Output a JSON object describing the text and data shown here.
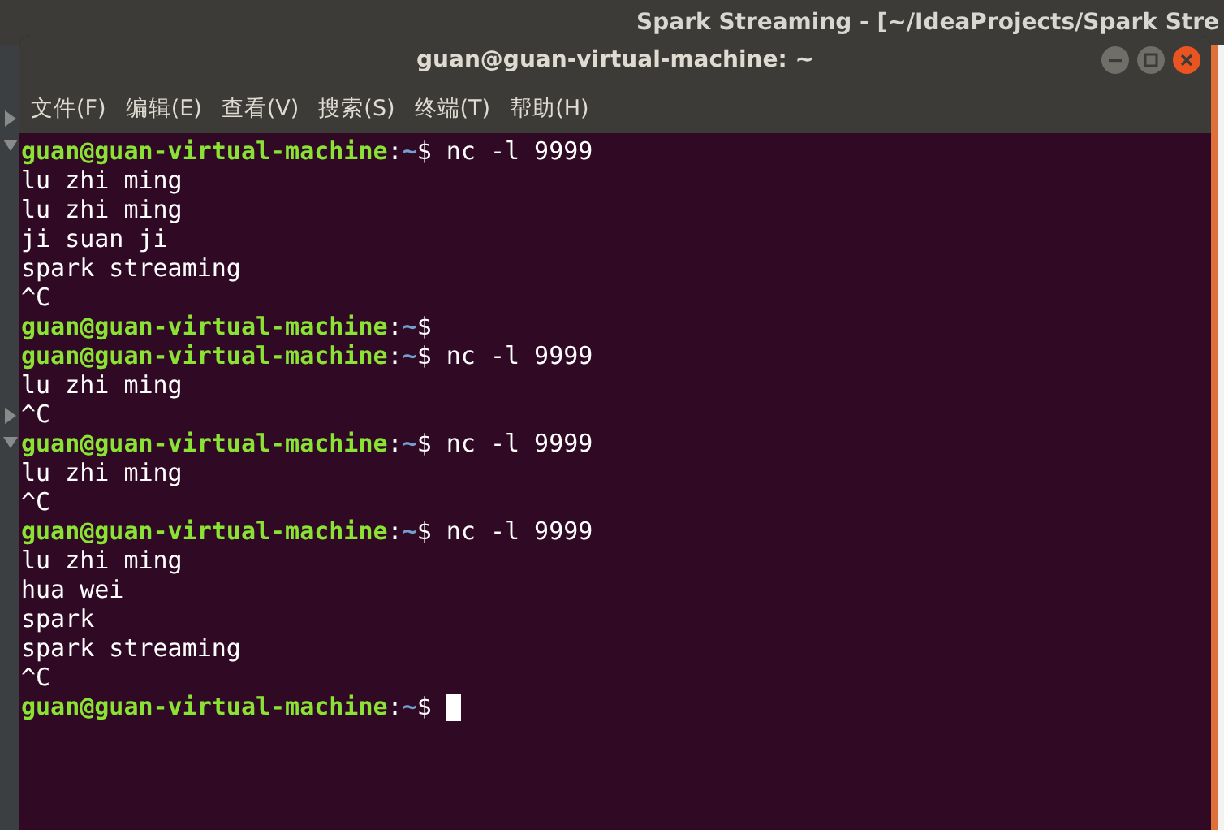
{
  "background_window": {
    "title": "Spark Streaming - [~/IdeaProjects/Spark Stre"
  },
  "terminal": {
    "title": "guan@guan-virtual-machine: ~",
    "menu": [
      "文件(F)",
      "编辑(E)",
      "查看(V)",
      "搜索(S)",
      "终端(T)",
      "帮助(H)"
    ],
    "lines": [
      {
        "kind": "prompt",
        "user_host": "guan@guan-virtual-machine",
        "separator": ":",
        "path": "~",
        "symbol": "$",
        "command": "nc -l 9999"
      },
      {
        "kind": "output",
        "text": "lu zhi ming"
      },
      {
        "kind": "output",
        "text": "lu zhi ming"
      },
      {
        "kind": "output",
        "text": "ji suan ji"
      },
      {
        "kind": "output",
        "text": "spark streaming"
      },
      {
        "kind": "output",
        "text": "^C"
      },
      {
        "kind": "prompt",
        "user_host": "guan@guan-virtual-machine",
        "separator": ":",
        "path": "~",
        "symbol": "$"
      },
      {
        "kind": "prompt",
        "user_host": "guan@guan-virtual-machine",
        "separator": ":",
        "path": "~",
        "symbol": "$",
        "command": "nc -l 9999"
      },
      {
        "kind": "output",
        "text": "lu zhi ming"
      },
      {
        "kind": "output",
        "text": "^C"
      },
      {
        "kind": "prompt",
        "user_host": "guan@guan-virtual-machine",
        "separator": ":",
        "path": "~",
        "symbol": "$",
        "command": "nc -l 9999"
      },
      {
        "kind": "output",
        "text": "lu zhi ming"
      },
      {
        "kind": "output",
        "text": "^C"
      },
      {
        "kind": "prompt",
        "user_host": "guan@guan-virtual-machine",
        "separator": ":",
        "path": "~",
        "symbol": "$",
        "command": "nc -l 9999"
      },
      {
        "kind": "output",
        "text": "lu zhi ming"
      },
      {
        "kind": "output",
        "text": "hua wei"
      },
      {
        "kind": "output",
        "text": "spark"
      },
      {
        "kind": "output",
        "text": "spark streaming"
      },
      {
        "kind": "output",
        "text": "^C"
      },
      {
        "kind": "prompt",
        "user_host": "guan@guan-virtual-machine",
        "separator": ":",
        "path": "~",
        "symbol": "$",
        "cursor": true
      }
    ]
  }
}
